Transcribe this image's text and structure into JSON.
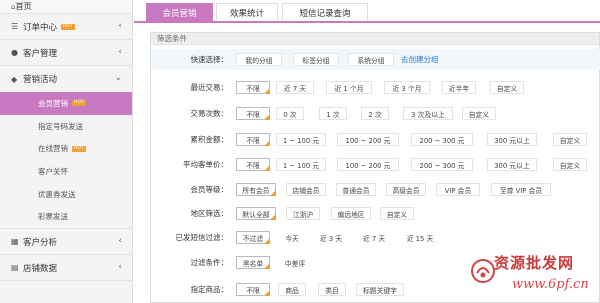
{
  "sidebar": {
    "top_label": "首页",
    "sections": [
      {
        "label": "订单中心",
        "icon": "list-icon",
        "hot": "HOT"
      },
      {
        "label": "客户管理",
        "icon": "user-icon"
      },
      {
        "label": "营销活动",
        "icon": "chat-icon"
      }
    ],
    "subitems": [
      {
        "label": "会员营销",
        "hot": "HOT",
        "active": true
      },
      {
        "label": "指定号码发送"
      },
      {
        "label": "在线营销",
        "hot": "HOT"
      },
      {
        "label": "客户关怀"
      },
      {
        "label": "优惠券发送"
      },
      {
        "label": "彩票发送"
      }
    ],
    "bottom_sections": [
      {
        "label": "客户分析",
        "icon": "grid-icon"
      },
      {
        "label": "店铺数据",
        "icon": "store-icon"
      }
    ]
  },
  "tabs": [
    {
      "label": "会员营销",
      "active": true
    },
    {
      "label": "效果统计"
    },
    {
      "label": "短信记录查询"
    }
  ],
  "filter": {
    "title": "筛选条件",
    "rows": [
      {
        "label": "快速选择：",
        "options": [
          "我的分组",
          "标签分组",
          "系统分组"
        ],
        "link": "去创建分组"
      },
      {
        "label": "最近交易：",
        "options": [
          "不限",
          "近 7 天",
          "近 1 个月",
          "近 3 个月",
          "近半年",
          "自定义"
        ]
      },
      {
        "label": "交易次数：",
        "options": [
          "不限",
          "0 次",
          "1 次",
          "2 次",
          "3 次及以上",
          "自定义"
        ]
      },
      {
        "label": "累积金额：",
        "options": [
          "不限",
          "1 ~ 100 元",
          "100 ~ 200 元",
          "200 ~ 300 元",
          "300 元以上",
          "自定义"
        ]
      },
      {
        "label": "平均客单价：",
        "options": [
          "不限",
          "1 ~ 100 元",
          "100 ~ 200 元",
          "200 ~ 300 元",
          "300 元以上",
          "自定义"
        ]
      },
      {
        "label": "会员等级：",
        "options": [
          "所有会员",
          "店铺会员",
          "普通会员",
          "高级会员",
          "VIP 会员",
          "至尊 VIP 会员"
        ]
      },
      {
        "label": "地区筛选：",
        "options": [
          "默认全部",
          "江浙沪",
          "偏远地区",
          "自定义"
        ]
      },
      {
        "label": "已发短信过滤：",
        "options": [
          "不过滤",
          "今天",
          "近 3 天",
          "近 7 天",
          "近 15 天"
        ]
      },
      {
        "label": "过滤条件：",
        "options": [
          "黑名单",
          "中差评"
        ]
      },
      {
        "label": "指定商品：",
        "options": [
          "不限",
          "商品",
          "类目",
          "标题关键字"
        ]
      }
    ]
  },
  "watermark": {
    "title": "资源批发网",
    "url": "www.6pf.cn"
  },
  "colors": {
    "accent": "#c879c2",
    "selected_corner": "#f0a030",
    "link": "#2277dd",
    "row_shade": "#f1f7fb"
  }
}
